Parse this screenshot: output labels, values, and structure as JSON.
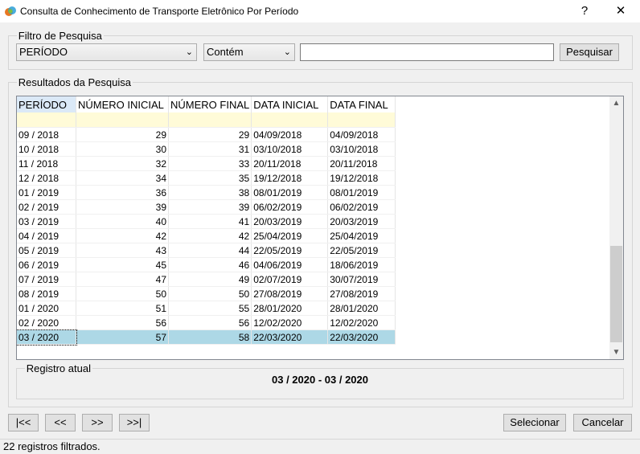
{
  "window": {
    "title": "Consulta de Conhecimento de Transporte Eletrônico Por Período",
    "help": "?",
    "close": "✕"
  },
  "filter": {
    "legend": "Filtro de Pesquisa",
    "field_value": "PERÍODO",
    "operator_value": "Contém",
    "search_value": "",
    "search_button": "Pesquisar"
  },
  "results": {
    "legend": "Resultados da Pesquisa",
    "columns": [
      "PERÍODO",
      "NÚMERO INICIAL",
      "NÚMERO FINAL",
      "DATA INICIAL",
      "DATA FINAL"
    ],
    "rows": [
      [
        "09 / 2018",
        "29",
        "29",
        "04/09/2018",
        "04/09/2018"
      ],
      [
        "10 / 2018",
        "30",
        "31",
        "03/10/2018",
        "03/10/2018"
      ],
      [
        "11 / 2018",
        "32",
        "33",
        "20/11/2018",
        "20/11/2018"
      ],
      [
        "12 / 2018",
        "34",
        "35",
        "19/12/2018",
        "19/12/2018"
      ],
      [
        "01 / 2019",
        "36",
        "38",
        "08/01/2019",
        "08/01/2019"
      ],
      [
        "02 / 2019",
        "39",
        "39",
        "06/02/2019",
        "06/02/2019"
      ],
      [
        "03 / 2019",
        "40",
        "41",
        "20/03/2019",
        "20/03/2019"
      ],
      [
        "04 / 2019",
        "42",
        "42",
        "25/04/2019",
        "25/04/2019"
      ],
      [
        "05 / 2019",
        "43",
        "44",
        "22/05/2019",
        "22/05/2019"
      ],
      [
        "06 / 2019",
        "45",
        "46",
        "04/06/2019",
        "18/06/2019"
      ],
      [
        "07 / 2019",
        "47",
        "49",
        "02/07/2019",
        "30/07/2019"
      ],
      [
        "08 / 2019",
        "50",
        "50",
        "27/08/2019",
        "27/08/2019"
      ],
      [
        "01 / 2020",
        "51",
        "55",
        "28/01/2020",
        "28/01/2020"
      ],
      [
        "02 / 2020",
        "56",
        "56",
        "12/02/2020",
        "12/02/2020"
      ],
      [
        "03 / 2020",
        "57",
        "58",
        "22/03/2020",
        "22/03/2020"
      ]
    ],
    "selected_index": 14
  },
  "current_record": {
    "legend": "Registro atual",
    "value": "03 / 2020 - 03 / 2020"
  },
  "nav": {
    "first": "|<<",
    "prev": "<<",
    "next": ">>",
    "last": ">>|"
  },
  "actions": {
    "select": "Selecionar",
    "cancel": "Cancelar"
  },
  "status": "22 registros filtrados.",
  "colors": {
    "selection": "#add8e6",
    "filter_row": "#fffbd8"
  }
}
